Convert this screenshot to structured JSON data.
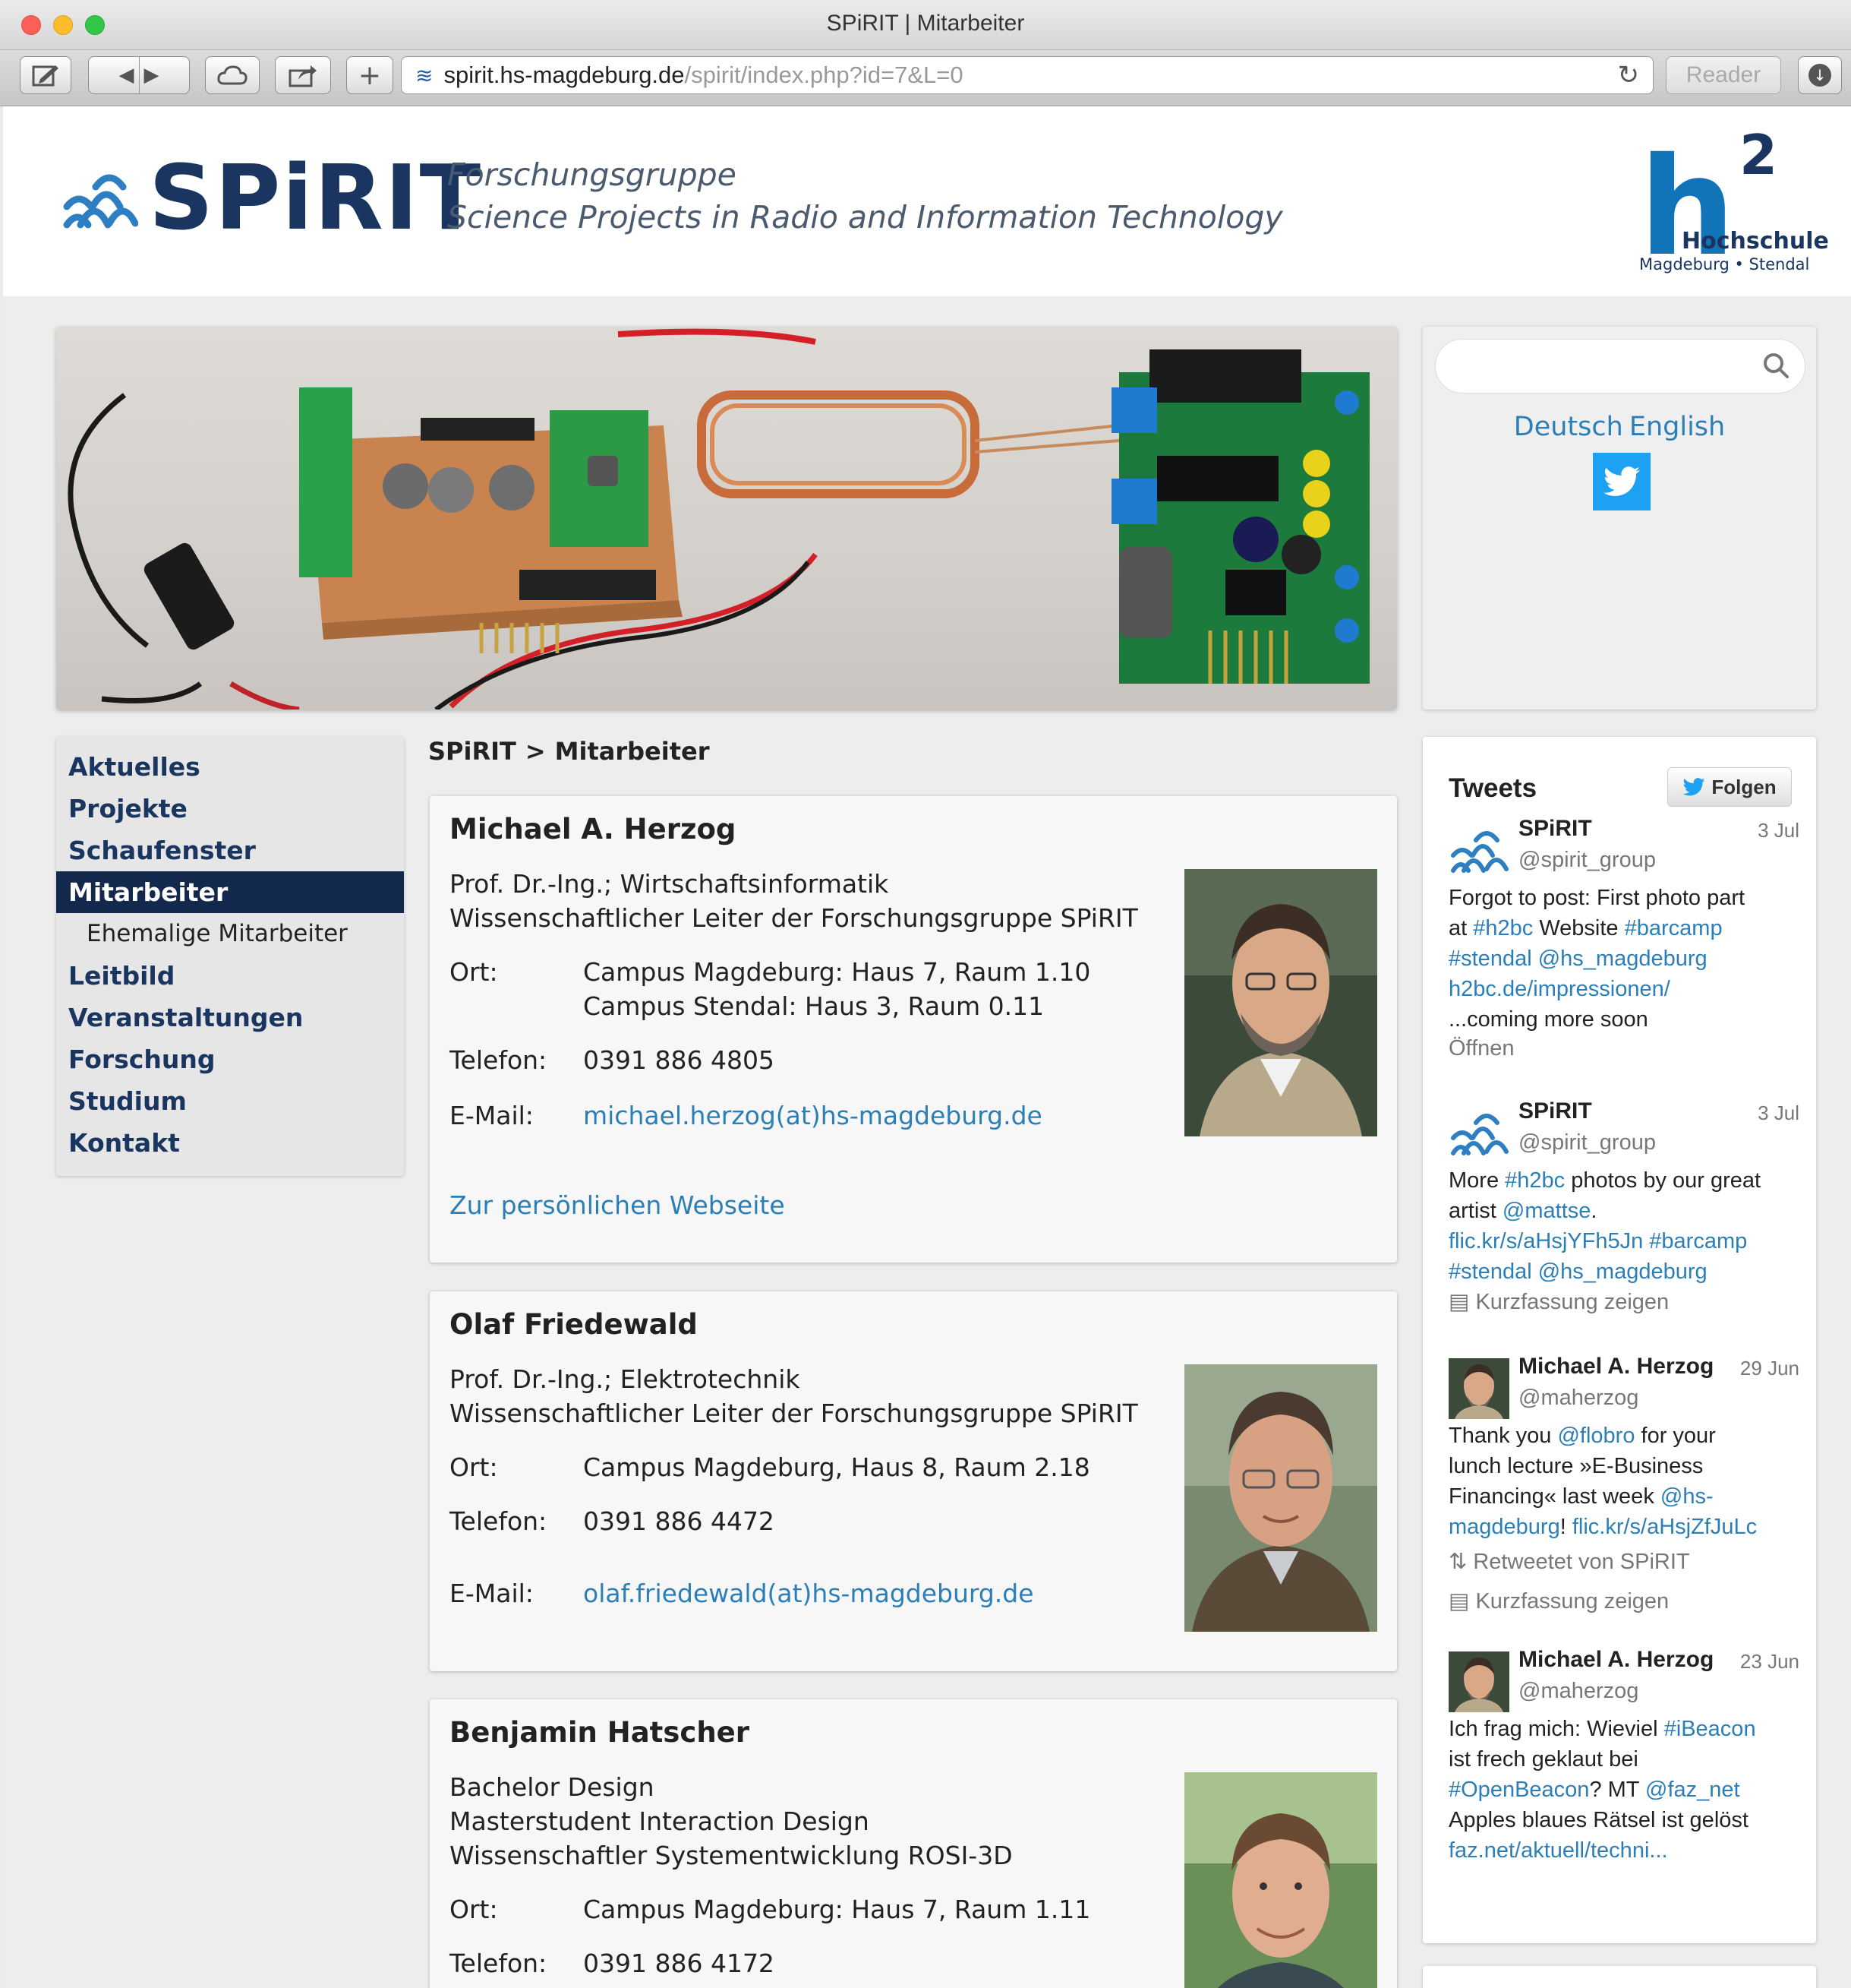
{
  "browser": {
    "window_title": "SPiRIT | Mitarbeiter",
    "url_host": "spirit.hs-magdeburg.de",
    "url_path": "/spirit/index.php?id=7&L=0",
    "reader_label": "Reader",
    "plus_label": "+"
  },
  "header": {
    "logo_text": "SPiRIT",
    "tagline_1": "Forschungsgruppe",
    "tagline_2": "Science Projects in Radio and Information Technology",
    "hs_logo_h": "h",
    "hs_logo_sup": "2",
    "hs_logo_name": "Hochschule",
    "hs_logo_sub": "Magdeburg • Stendal"
  },
  "sidebar": {
    "lang_de": "Deutsch",
    "lang_en": "English",
    "search_placeholder": ""
  },
  "nav": {
    "items": [
      {
        "label": "Aktuelles"
      },
      {
        "label": "Projekte"
      },
      {
        "label": "Schaufenster"
      },
      {
        "label": "Mitarbeiter"
      },
      {
        "label": "Ehemalige Mitarbeiter"
      },
      {
        "label": "Leitbild"
      },
      {
        "label": "Veranstaltungen"
      },
      {
        "label": "Forschung"
      },
      {
        "label": "Studium"
      },
      {
        "label": "Kontakt"
      }
    ]
  },
  "breadcrumb": {
    "root": "SPiRIT",
    "sep": ">",
    "current": "Mitarbeiter"
  },
  "labels": {
    "ort": "Ort:",
    "telefon": "Telefon:",
    "email": "E-Mail:"
  },
  "people": [
    {
      "name": "Michael A. Herzog",
      "title_1": "Prof. Dr.-Ing.; Wirtschaftsinformatik",
      "title_2": "Wissenschaftlicher Leiter der Forschungsgruppe SPiRIT",
      "ort_1": "Campus Magdeburg: Haus 7, Raum 1.10",
      "ort_2": "Campus Stendal: Haus 3, Raum 0.11",
      "telefon": "0391 886 4805",
      "email": "michael.herzog(at)hs-magdeburg.de",
      "website": "Zur persönlichen Webseite"
    },
    {
      "name": "Olaf Friedewald",
      "title_1": "Prof. Dr.-Ing.; Elektrotechnik",
      "title_2": "Wissenschaftlicher Leiter der Forschungsgruppe SPiRIT",
      "ort_1": "Campus Magdeburg, Haus 8, Raum 2.18",
      "telefon": "0391 886 4472",
      "email": "olaf.friedewald(at)hs-magdeburg.de"
    },
    {
      "name": "Benjamin Hatscher",
      "title_1": "Bachelor Design",
      "title_2": "Masterstudent Interaction Design",
      "title_3": "Wissenschaftler Systementwicklung ROSI-3D",
      "ort_1": "Campus Magdeburg: Haus 7, Raum 1.11",
      "telefon": "0391 886 4172"
    }
  ],
  "tweets": {
    "title": "Tweets",
    "follow_label": "Folgen",
    "items": [
      {
        "name": "SPiRIT",
        "handle": "@spirit_group",
        "date": "3 Jul",
        "l1a": "Forgot to post: First photo part",
        "l2a": "at ",
        "l2b": "#h2bc",
        "l2c": " Website ",
        "l2d": "#barcamp",
        "l3a": "#stendal",
        "l3b": " @hs_magdeburg",
        "l4a": "h2bc.de/impressionen/",
        "l5a": "...coming more soon",
        "meta_1": "Öffnen"
      },
      {
        "name": "SPiRIT",
        "handle": "@spirit_group",
        "date": "3 Jul",
        "l1a": "More ",
        "l1b": "#h2bc",
        "l1c": " photos by our great",
        "l2a": "artist ",
        "l2b": "@mattse",
        "l2c": ".",
        "l3a": "flic.kr/s/aHsjYFh5Jn",
        "l3b": " #barcamp",
        "l4a": "#stendal",
        "l4b": " @hs_magdeburg",
        "meta_1": "Kurzfassung zeigen"
      },
      {
        "name": "Michael A. Herzog",
        "handle": "@maherzog",
        "date": "29 Jun",
        "l1a": "Thank you ",
        "l1b": "@flobro",
        "l1c": " for your",
        "l2a": "lunch lecture »E-Business",
        "l3a": "Financing« last week ",
        "l3b": "@hs-",
        "l4a": "magdeburg",
        "l4b": "! ",
        "l4c": "flic.kr/s/aHsjZfJuLc",
        "meta_1": "Retweetet von SPiRIT",
        "meta_2": "Kurzfassung zeigen"
      },
      {
        "name": "Michael A. Herzog",
        "handle": "@maherzog",
        "date": "23 Jun",
        "l1a": "Ich frag mich: Wieviel ",
        "l1b": "#iBeacon",
        "l2a": "ist frech geklaut bei",
        "l3a": "#OpenBeacon",
        "l3b": "? MT ",
        "l3c": "@faz_net",
        "l4a": "Apples blaues Rätsel ist gelöst",
        "l5a": "faz.net/aktuell/techni..."
      }
    ]
  }
}
